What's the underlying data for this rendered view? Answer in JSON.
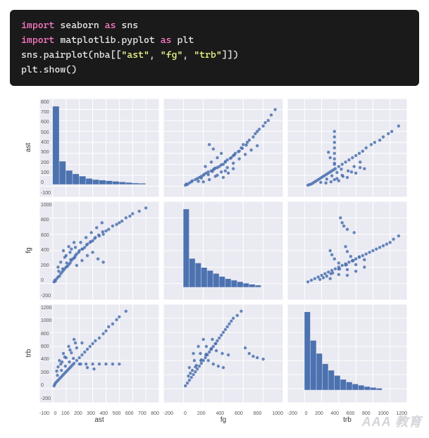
{
  "code": {
    "lines": [
      [
        [
          "kw",
          "import"
        ],
        [
          "",
          " seaborn "
        ],
        [
          "kw",
          "as"
        ],
        [
          "",
          " sns"
        ]
      ],
      [
        [
          "kw",
          "import"
        ],
        [
          "",
          " matplotlib.pyplot "
        ],
        [
          "kw",
          "as"
        ],
        [
          "",
          " plt"
        ]
      ],
      [
        [
          "",
          "sns.pairplot(nba[["
        ],
        [
          "str",
          "\"ast\""
        ],
        [
          "",
          ", "
        ],
        [
          "str",
          "\"fg\""
        ],
        [
          "",
          ", "
        ],
        [
          "str",
          "\"trb\""
        ],
        [
          "",
          "]])"
        ]
      ],
      [
        [
          "",
          "plt.show()"
        ]
      ]
    ]
  },
  "chart_data": {
    "type": "pairplot",
    "variables": [
      "ast",
      "fg",
      "trb"
    ],
    "axis_ranges": {
      "ast": [
        -100,
        800
      ],
      "fg": [
        -200,
        1000
      ],
      "trb": [
        -200,
        1200
      ]
    },
    "y_ticks": {
      "ast": [
        -100,
        0,
        100,
        200,
        300,
        400,
        500,
        600,
        700,
        800
      ],
      "fg": [
        -200,
        0,
        200,
        400,
        600,
        800,
        1000
      ],
      "trb": [
        -200,
        0,
        200,
        400,
        600,
        800,
        1000,
        1200
      ]
    },
    "x_ticks": {
      "ast": [
        -100,
        0,
        100,
        200,
        300,
        400,
        500,
        600,
        700,
        800
      ],
      "fg": [
        -200,
        0,
        200,
        400,
        600,
        800,
        1000
      ],
      "trb": [
        -200,
        0,
        200,
        400,
        600,
        800,
        1000,
        1200
      ]
    },
    "histograms": {
      "ast": {
        "bin_edges": [
          0,
          50,
          100,
          150,
          200,
          250,
          300,
          350,
          400,
          450,
          500,
          550,
          600,
          650,
          700
        ],
        "counts": [
          680,
          200,
          120,
          90,
          70,
          50,
          40,
          35,
          30,
          25,
          20,
          15,
          10,
          8
        ]
      },
      "fg": {
        "bin_edges": [
          0,
          60,
          120,
          180,
          240,
          300,
          360,
          420,
          480,
          540,
          600,
          660,
          720,
          780
        ],
        "counts": [
          520,
          190,
          160,
          130,
          110,
          90,
          70,
          55,
          45,
          35,
          25,
          18,
          12
        ]
      },
      "trb": {
        "bin_edges": [
          0,
          70,
          140,
          210,
          280,
          350,
          420,
          490,
          560,
          630,
          700,
          770,
          840,
          910
        ],
        "counts": [
          600,
          380,
          280,
          200,
          150,
          110,
          80,
          60,
          45,
          35,
          25,
          18,
          12
        ]
      }
    },
    "scatter_samples": {
      "ast_fg": [
        [
          10,
          20
        ],
        [
          15,
          40
        ],
        [
          20,
          30
        ],
        [
          30,
          60
        ],
        [
          40,
          80
        ],
        [
          50,
          90
        ],
        [
          60,
          120
        ],
        [
          70,
          140
        ],
        [
          80,
          160
        ],
        [
          90,
          180
        ],
        [
          100,
          200
        ],
        [
          110,
          210
        ],
        [
          120,
          230
        ],
        [
          130,
          250
        ],
        [
          140,
          280
        ],
        [
          150,
          300
        ],
        [
          160,
          310
        ],
        [
          170,
          340
        ],
        [
          180,
          360
        ],
        [
          200,
          400
        ],
        [
          220,
          420
        ],
        [
          240,
          440
        ],
        [
          260,
          480
        ],
        [
          280,
          500
        ],
        [
          300,
          520
        ],
        [
          320,
          560
        ],
        [
          350,
          580
        ],
        [
          380,
          600
        ],
        [
          400,
          640
        ],
        [
          420,
          660
        ],
        [
          450,
          700
        ],
        [
          480,
          720
        ],
        [
          500,
          740
        ],
        [
          520,
          760
        ],
        [
          550,
          800
        ],
        [
          580,
          820
        ],
        [
          600,
          850
        ],
        [
          650,
          880
        ],
        [
          700,
          920
        ],
        [
          80,
          400
        ],
        [
          120,
          450
        ],
        [
          160,
          500
        ],
        [
          180,
          220
        ],
        [
          220,
          280
        ],
        [
          260,
          340
        ],
        [
          40,
          200
        ],
        [
          60,
          260
        ],
        [
          100,
          340
        ],
        [
          140,
          420
        ],
        [
          300,
          380
        ],
        [
          340,
          300
        ],
        [
          380,
          260
        ],
        [
          90,
          320
        ],
        [
          130,
          380
        ],
        [
          170,
          440
        ],
        [
          210,
          500
        ],
        [
          250,
          560
        ],
        [
          290,
          620
        ],
        [
          330,
          680
        ],
        [
          370,
          740
        ],
        [
          45,
          150
        ],
        [
          75,
          180
        ],
        [
          105,
          250
        ],
        [
          135,
          290
        ],
        [
          165,
          320
        ],
        [
          195,
          380
        ],
        [
          225,
          420
        ],
        [
          255,
          470
        ],
        [
          285,
          510
        ],
        [
          315,
          550
        ],
        [
          345,
          590
        ],
        [
          375,
          630
        ]
      ],
      "ast_trb": [
        [
          10,
          40
        ],
        [
          15,
          60
        ],
        [
          20,
          80
        ],
        [
          30,
          100
        ],
        [
          40,
          120
        ],
        [
          50,
          140
        ],
        [
          60,
          160
        ],
        [
          70,
          180
        ],
        [
          80,
          200
        ],
        [
          90,
          220
        ],
        [
          100,
          240
        ],
        [
          110,
          260
        ],
        [
          120,
          280
        ],
        [
          130,
          300
        ],
        [
          140,
          320
        ],
        [
          150,
          340
        ],
        [
          160,
          360
        ],
        [
          180,
          400
        ],
        [
          200,
          440
        ],
        [
          220,
          480
        ],
        [
          240,
          520
        ],
        [
          260,
          560
        ],
        [
          280,
          600
        ],
        [
          300,
          640
        ],
        [
          320,
          680
        ],
        [
          350,
          720
        ],
        [
          380,
          780
        ],
        [
          400,
          820
        ],
        [
          420,
          880
        ],
        [
          450,
          920
        ],
        [
          480,
          980
        ],
        [
          500,
          1020
        ],
        [
          550,
          1100
        ],
        [
          50,
          400
        ],
        [
          80,
          500
        ],
        [
          120,
          600
        ],
        [
          160,
          700
        ],
        [
          200,
          350
        ],
        [
          250,
          350
        ],
        [
          300,
          350
        ],
        [
          350,
          350
        ],
        [
          400,
          350
        ],
        [
          450,
          350
        ],
        [
          500,
          350
        ],
        [
          30,
          250
        ],
        [
          60,
          350
        ],
        [
          90,
          450
        ],
        [
          130,
          550
        ],
        [
          170,
          650
        ],
        [
          210,
          350
        ],
        [
          260,
          300
        ],
        [
          310,
          280
        ],
        [
          40,
          310
        ],
        [
          70,
          380
        ],
        [
          100,
          440
        ],
        [
          140,
          510
        ],
        [
          180,
          580
        ],
        [
          220,
          650
        ],
        [
          35,
          190
        ],
        [
          65,
          260
        ],
        [
          95,
          320
        ],
        [
          125,
          380
        ],
        [
          155,
          430
        ]
      ],
      "fg_trb": [
        [
          20,
          40
        ],
        [
          40,
          80
        ],
        [
          60,
          120
        ],
        [
          80,
          160
        ],
        [
          100,
          200
        ],
        [
          120,
          240
        ],
        [
          140,
          280
        ],
        [
          160,
          320
        ],
        [
          180,
          360
        ],
        [
          200,
          400
        ],
        [
          220,
          440
        ],
        [
          240,
          480
        ],
        [
          260,
          520
        ],
        [
          280,
          560
        ],
        [
          300,
          600
        ],
        [
          320,
          640
        ],
        [
          340,
          680
        ],
        [
          360,
          720
        ],
        [
          380,
          760
        ],
        [
          400,
          800
        ],
        [
          420,
          840
        ],
        [
          440,
          880
        ],
        [
          460,
          920
        ],
        [
          480,
          960
        ],
        [
          500,
          1000
        ],
        [
          540,
          1040
        ],
        [
          580,
          1100
        ],
        [
          620,
          580
        ],
        [
          660,
          500
        ],
        [
          700,
          460
        ],
        [
          740,
          440
        ],
        [
          800,
          420
        ],
        [
          100,
          500
        ],
        [
          150,
          600
        ],
        [
          200,
          700
        ],
        [
          250,
          400
        ],
        [
          300,
          350
        ],
        [
          350,
          320
        ],
        [
          400,
          300
        ],
        [
          60,
          300
        ],
        [
          110,
          400
        ],
        [
          170,
          500
        ],
        [
          230,
          600
        ],
        [
          290,
          700
        ],
        [
          50,
          180
        ],
        [
          90,
          260
        ],
        [
          130,
          330
        ],
        [
          180,
          410
        ],
        [
          230,
          490
        ],
        [
          280,
          570
        ],
        [
          330,
          540
        ],
        [
          390,
          500
        ],
        [
          450,
          480
        ],
        [
          70,
          220
        ],
        [
          120,
          310
        ],
        [
          175,
          400
        ],
        [
          225,
          480
        ],
        [
          275,
          560
        ],
        [
          325,
          640
        ]
      ]
    }
  },
  "watermark": "AAA 教育"
}
